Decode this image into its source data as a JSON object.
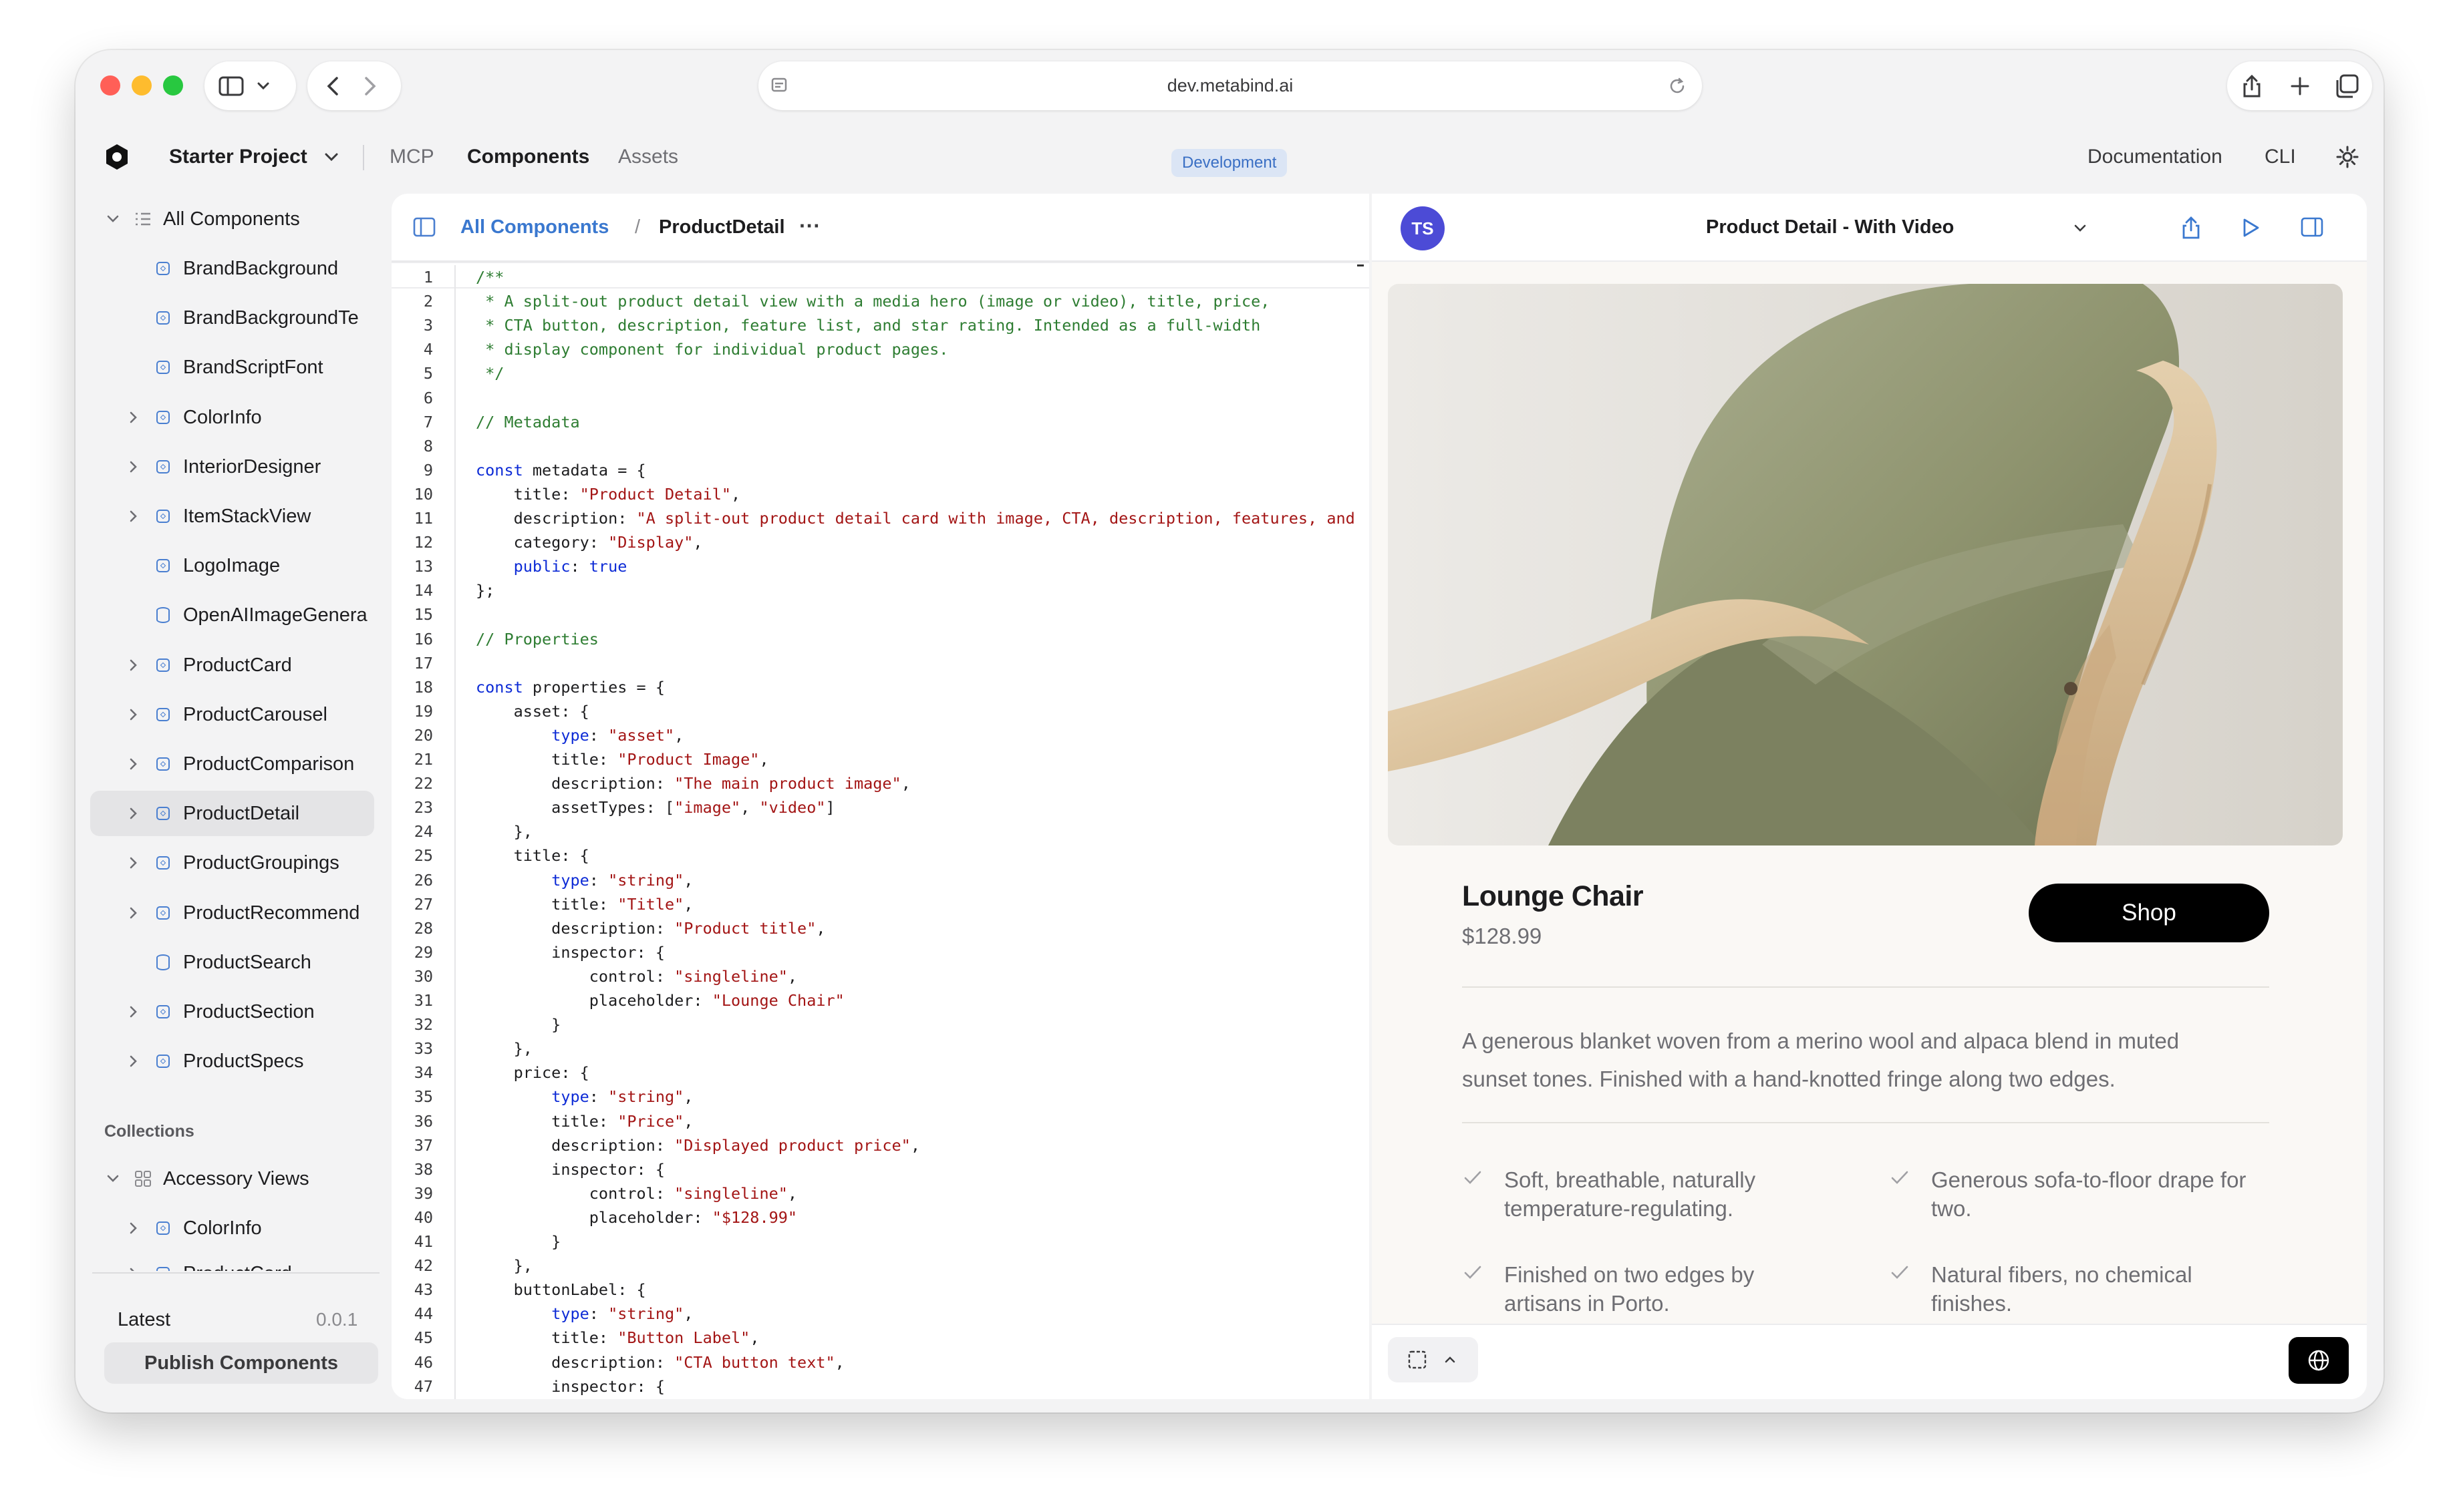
{
  "browser": {
    "url": "dev.metabind.ai",
    "traffic_lights": [
      "#ff5f57",
      "#febc2e",
      "#28c840"
    ]
  },
  "app": {
    "project": "Starter Project",
    "nav": [
      "MCP",
      "Components",
      "Assets"
    ],
    "active_nav": "Components",
    "env_badge": "Development",
    "right_links": [
      "Documentation",
      "CLI"
    ]
  },
  "sidebar": {
    "root": "All Components",
    "items": [
      {
        "label": "BrandBackground",
        "expandable": false,
        "icon": "component-icon"
      },
      {
        "label": "BrandBackgroundTe",
        "expandable": false,
        "icon": "component-icon"
      },
      {
        "label": "BrandScriptFont",
        "expandable": false,
        "icon": "component-icon"
      },
      {
        "label": "ColorInfo",
        "expandable": true,
        "icon": "component-icon"
      },
      {
        "label": "InteriorDesigner",
        "expandable": true,
        "icon": "component-icon"
      },
      {
        "label": "ItemStackView",
        "expandable": true,
        "icon": "component-icon"
      },
      {
        "label": "LogoImage",
        "expandable": false,
        "icon": "component-icon"
      },
      {
        "label": "OpenAIImageGenera",
        "expandable": false,
        "icon": "database-icon"
      },
      {
        "label": "ProductCard",
        "expandable": true,
        "icon": "component-icon"
      },
      {
        "label": "ProductCarousel",
        "expandable": true,
        "icon": "component-icon"
      },
      {
        "label": "ProductComparison",
        "expandable": true,
        "icon": "component-icon"
      },
      {
        "label": "ProductDetail",
        "expandable": true,
        "icon": "component-icon",
        "selected": true
      },
      {
        "label": "ProductGroupings",
        "expandable": true,
        "icon": "component-icon"
      },
      {
        "label": "ProductRecommend",
        "expandable": true,
        "icon": "component-icon"
      },
      {
        "label": "ProductSearch",
        "expandable": false,
        "icon": "database-icon"
      },
      {
        "label": "ProductSection",
        "expandable": true,
        "icon": "component-icon"
      },
      {
        "label": "ProductSpecs",
        "expandable": true,
        "icon": "component-icon"
      }
    ],
    "collections_label": "Collections",
    "collections": [
      {
        "label": "Accessory Views",
        "children": [
          "ColorInfo",
          "ProductCard"
        ]
      }
    ],
    "latest_label": "Latest",
    "version": "0.0.1",
    "publish_label": "Publish Components"
  },
  "editor": {
    "breadcrumb_root": "All Components",
    "breadcrumb_sep": "/",
    "breadcrumb_current": "ProductDetail",
    "more": "···",
    "lines": [
      "1|/**",
      "2| * A split-out product detail view with a media hero (image or video), title, price,",
      "3| * CTA button, description, feature list, and star rating. Intended as a full-width",
      "4| * display component for individual product pages.",
      "5| */",
      "6|",
      "7|// Metadata",
      "8|",
      "9|const metadata = {",
      "10|    title: \"Product Detail\",",
      "11|    description: \"A split-out product detail card with image, CTA, description, features, and",
      "12|    category: \"Display\",",
      "13|    public: true",
      "14|};",
      "15|",
      "16|// Properties",
      "17|",
      "18|const properties = {",
      "19|    asset: {",
      "20|        type: \"asset\",",
      "21|        title: \"Product Image\",",
      "22|        description: \"The main product image\",",
      "23|        assetTypes: [\"image\", \"video\"]",
      "24|    },",
      "25|    title: {",
      "26|        type: \"string\",",
      "27|        title: \"Title\",",
      "28|        description: \"Product title\",",
      "29|        inspector: {",
      "30|            control: \"singleline\",",
      "31|            placeholder: \"Lounge Chair\"",
      "32|        }",
      "33|    },",
      "34|    price: {",
      "35|        type: \"string\",",
      "36|        title: \"Price\",",
      "37|        description: \"Displayed product price\",",
      "38|        inspector: {",
      "39|            control: \"singleline\",",
      "40|            placeholder: \"$128.99\"",
      "41|        }",
      "42|    },",
      "43|    buttonLabel: {",
      "44|        type: \"string\",",
      "45|        title: \"Button Label\",",
      "46|        description: \"CTA button text\",",
      "47|        inspector: {"
    ]
  },
  "preview": {
    "avatar": "TS",
    "variant": "Product Detail - With Video",
    "product": {
      "title": "Lounge Chair",
      "price": "$128.99",
      "cta": "Shop",
      "description_1": "A generous blanket woven from a merino wool and alpaca blend in muted",
      "description_2": "sunset tones. Finished with a hand-knotted fringe along two edges.",
      "features": [
        {
          "l1": "Soft, breathable, naturally",
          "l2": "temperature-regulating."
        },
        {
          "l1": "Generous sofa-to-floor drape for",
          "l2": "two."
        },
        {
          "l1": "Finished on two edges by",
          "l2": "artisans in Porto."
        },
        {
          "l1": "Natural fibers, no chemical",
          "l2": "finishes."
        }
      ]
    }
  }
}
